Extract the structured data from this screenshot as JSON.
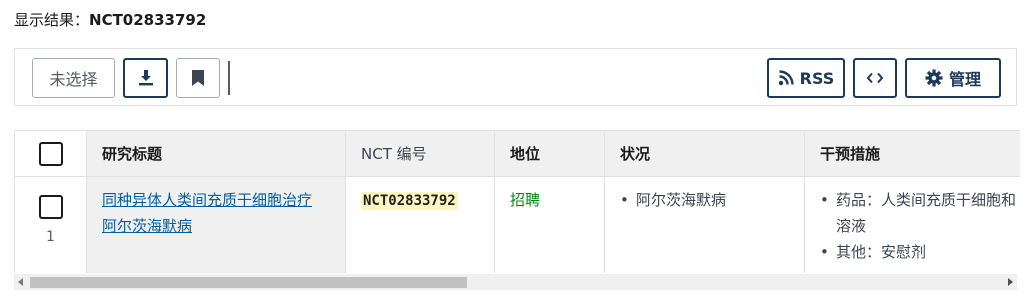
{
  "result": {
    "label": "显示结果：",
    "value": "NCT02833792"
  },
  "toolbar": {
    "unselect_label": "未选择",
    "rss_label": "RSS",
    "manage_label": "管理"
  },
  "table": {
    "headers": {
      "title": "研究标题",
      "nct": "NCT 编号",
      "status": "地位",
      "conditions": "状况",
      "interventions": "干预措施"
    },
    "rows": [
      {
        "row_number": "1",
        "title_line1": "同种异体人类间充质干细胞治疗",
        "title_line2": "阿尔茨海默病",
        "nct": "NCT02833792",
        "status": "招聘",
        "conditions": [
          "阿尔茨海默病"
        ],
        "interventions": [
          "药品：人类间充质干细胞和",
          "溶液",
          "其他：安慰剂"
        ]
      }
    ]
  },
  "colors": {
    "primary": "#1b3a5c",
    "link": "#005ea2",
    "status": "#008817",
    "highlight": "#fff5c2"
  }
}
